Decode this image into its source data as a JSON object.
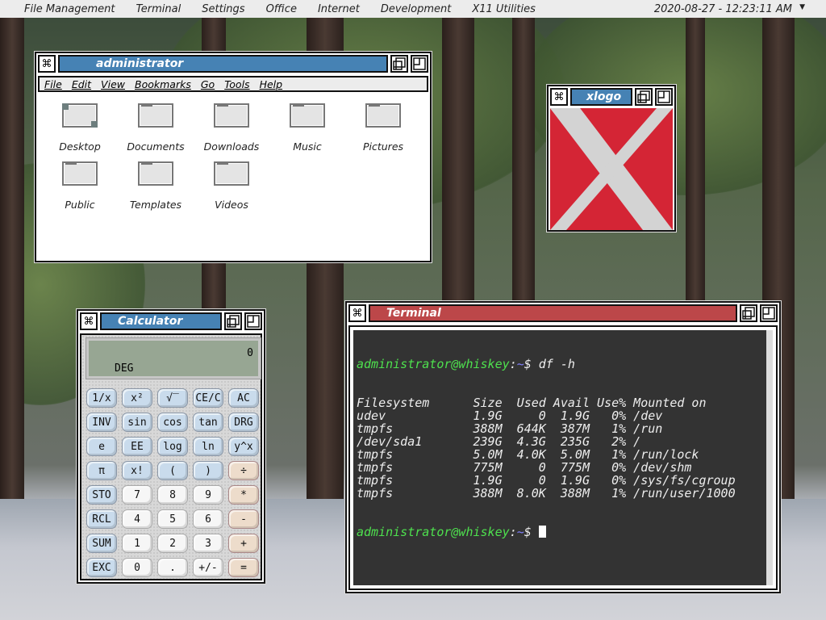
{
  "topbar": {
    "menus": [
      "File Management",
      "Terminal",
      "Settings",
      "Office",
      "Internet",
      "Development",
      "X11 Utilities"
    ],
    "clock": "2020-08-27  -  12:23:11 AM"
  },
  "filemanager": {
    "title": "administrator",
    "menu": [
      "File",
      "Edit",
      "View",
      "Bookmarks",
      "Go",
      "Tools",
      "Help"
    ],
    "items": [
      {
        "label": "Desktop",
        "icon": "desktop-icon"
      },
      {
        "label": "Documents",
        "icon": "folder-icon"
      },
      {
        "label": "Downloads",
        "icon": "folder-icon"
      },
      {
        "label": "Music",
        "icon": "folder-icon"
      },
      {
        "label": "Pictures",
        "icon": "folder-icon"
      },
      {
        "label": "Public",
        "icon": "folder-icon"
      },
      {
        "label": "Templates",
        "icon": "folder-icon"
      },
      {
        "label": "Videos",
        "icon": "folder-icon"
      }
    ]
  },
  "xlogo": {
    "title": "xlogo",
    "bg": "#d42535"
  },
  "calculator": {
    "title": "Calculator",
    "display": "0",
    "mode": "DEG",
    "buttons": [
      [
        "1/x",
        "x²",
        "√‾",
        "CE/C",
        "AC"
      ],
      [
        "INV",
        "sin",
        "cos",
        "tan",
        "DRG"
      ],
      [
        "e",
        "EE",
        "log",
        "ln",
        "y^x"
      ],
      [
        "π",
        "x!",
        "(",
        ")",
        "÷"
      ],
      [
        "STO",
        "7",
        "8",
        "9",
        "*"
      ],
      [
        "RCL",
        "4",
        "5",
        "6",
        "-"
      ],
      [
        "SUM",
        "1",
        "2",
        "3",
        "+"
      ],
      [
        "EXC",
        "0",
        ".",
        "+/-",
        "="
      ]
    ]
  },
  "terminal": {
    "title": "Terminal",
    "user": "administrator@whiskey",
    "sep": ":",
    "path": "~",
    "cmd": "$ df -h",
    "prompt_end": "$ ",
    "lines": [
      "Filesystem      Size  Used Avail Use% Mounted on",
      "udev            1.9G     0  1.9G   0% /dev",
      "tmpfs           388M  644K  387M   1% /run",
      "/dev/sda1       239G  4.3G  235G   2% /",
      "tmpfs           5.0M  4.0K  5.0M   1% /run/lock",
      "tmpfs           775M     0  775M   0% /dev/shm",
      "tmpfs           1.9G     0  1.9G   0% /sys/fs/cgroup",
      "tmpfs           388M  8.0K  388M   1% /run/user/1000"
    ]
  }
}
